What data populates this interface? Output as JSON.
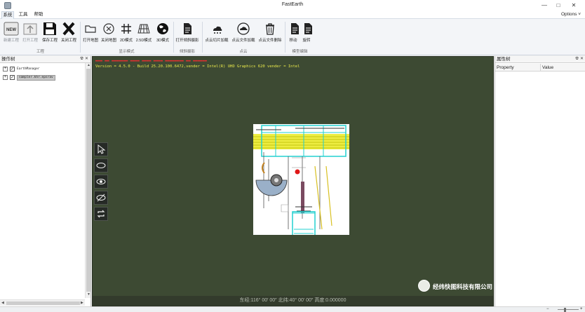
{
  "window": {
    "title": "FastEarth",
    "minimize_icon": "minimize-icon",
    "maximize_icon": "maximize-icon",
    "close_icon": "close-icon"
  },
  "menu": {
    "tabs": [
      "系统",
      "工具",
      "帮助"
    ],
    "active_tab": "系统",
    "options_label": "Options"
  },
  "ribbon": {
    "groups": [
      {
        "label": "工程",
        "buttons": [
          {
            "label": "新建工程",
            "icon": "new-project-icon",
            "enabled": false
          },
          {
            "label": "打开工程",
            "icon": "open-project-icon",
            "enabled": false
          },
          {
            "label": "保存工程",
            "icon": "save-icon",
            "enabled": true
          },
          {
            "label": "关闭工程",
            "icon": "close-project-icon",
            "enabled": true
          }
        ]
      },
      {
        "label": "显示模式",
        "buttons": [
          {
            "label": "打开地图",
            "icon": "folder-icon",
            "enabled": true
          },
          {
            "label": "关闭地图",
            "icon": "circle-x-icon",
            "enabled": true
          },
          {
            "label": "2D模式",
            "icon": "grid-icon",
            "enabled": true
          },
          {
            "label": "2.5D模式",
            "icon": "perspective-grid-icon",
            "enabled": true
          },
          {
            "label": "3D模式",
            "icon": "globe-icon",
            "enabled": true
          }
        ]
      },
      {
        "label": "倾斜摄影",
        "buttons": [
          {
            "label": "打开倾斜摄影",
            "icon": "document-icon",
            "enabled": true
          }
        ]
      },
      {
        "label": "点云",
        "buttons": [
          {
            "label": "点云切片加载",
            "icon": "point-cloud-icon",
            "enabled": true
          },
          {
            "label": "点云文件加载",
            "icon": "cloud-icon",
            "enabled": true
          },
          {
            "label": "点云文件删除",
            "icon": "trash-icon",
            "enabled": true
          }
        ]
      },
      {
        "label": "模型编辑",
        "buttons": [
          {
            "label": "移动",
            "icon": "move-document-icon",
            "enabled": true
          },
          {
            "label": "旋转",
            "icon": "rotate-document-icon",
            "enabled": true
          }
        ]
      }
    ]
  },
  "left_panel": {
    "title": "操作树",
    "pin_icon": "pin-icon",
    "close_icon": "close-icon",
    "tree": [
      {
        "label": "EarthManager",
        "checked": true,
        "selected": false
      },
      {
        "label": "sampler.khr.epsrav",
        "checked": true,
        "selected": true
      }
    ]
  },
  "viewport": {
    "info_line_1": "Version = 4.5.0 - Build 25.20.100.6472,vender =  Intel(R) UHD Graphics 620  vender = Intel",
    "tools": [
      "select-arrow-icon",
      "eye-outline-icon",
      "eye-filled-icon",
      "eye-hidden-icon",
      "refresh-icon"
    ],
    "coords": "东经:116° 00′ 00″   北纬:40° 00′ 00″   高度:0.000000",
    "brand_text": "经纬快图科技有限公司",
    "brand_icon": "globe-logo-icon"
  },
  "right_panel": {
    "title": "属性树",
    "columns": [
      "Property",
      "Value"
    ]
  },
  "colors": {
    "viewport_bg": "#3d4a33",
    "version_text": "#e8e84a",
    "red_overlay_text": "#e03030"
  }
}
